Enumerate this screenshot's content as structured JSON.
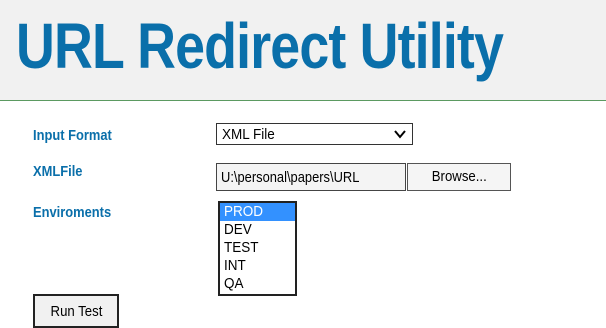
{
  "app": {
    "title": "URL Redirect Utility"
  },
  "colors": {
    "accent": "#0a6faa",
    "header_rule": "#5b9a61",
    "selected": "#3391ff"
  },
  "form": {
    "input_format": {
      "label": "Input Format",
      "selected": "XML File"
    },
    "xml_file": {
      "label": "XMLFile",
      "value": "U:\\personal\\papers\\URL",
      "browse_label": "Browse..."
    },
    "environments": {
      "label": "Enviroments",
      "options": [
        "PROD",
        "DEV",
        "TEST",
        "INT",
        "QA"
      ],
      "selected": "PROD"
    },
    "run_label": "Run Test"
  },
  "icons": {
    "select_arrow": "chevron-down-icon"
  }
}
